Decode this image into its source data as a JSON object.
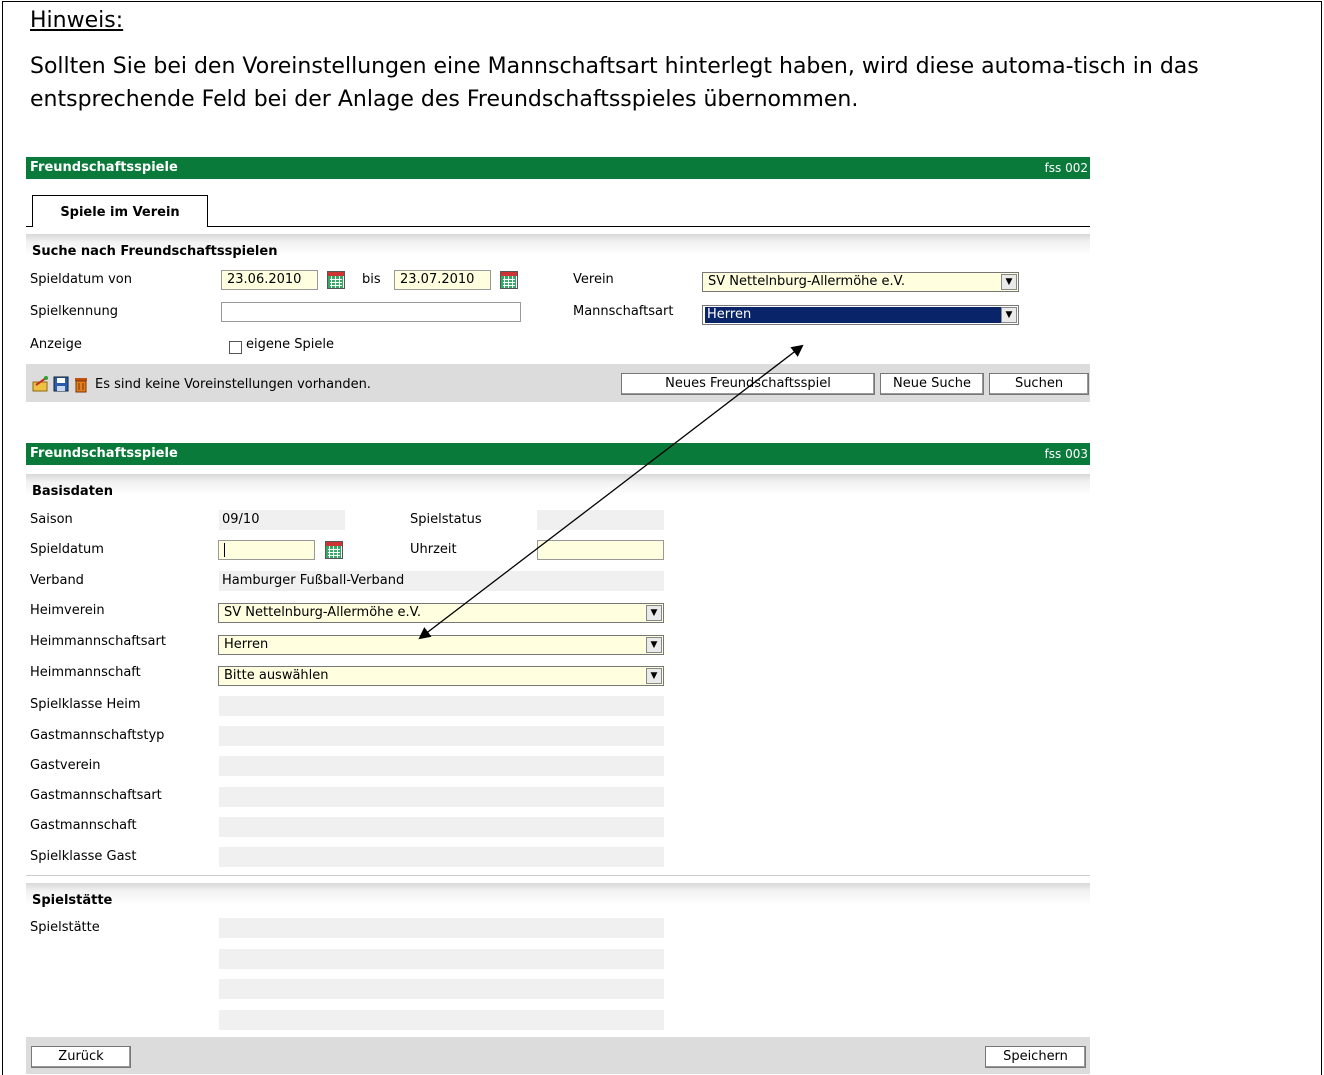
{
  "hint": {
    "title": "Hinweis:",
    "text": "Sollten Sie bei den Voreinstellungen eine Mannschaftsart hinterlegt haben, wird diese automa-tisch in das entsprechende Feld bei der Anlage des Freundschaftsspieles übernommen."
  },
  "search_panel": {
    "title": "Freundschaftsspiele",
    "code": "fss 002",
    "tab": "Spiele im Verein",
    "section_title": "Suche nach Freundschaftsspielen",
    "labels": {
      "date_from": "Spieldatum von",
      "to": "bis",
      "game_id": "Spielkennung",
      "display": "Anzeige",
      "club": "Verein",
      "team_type": "Mannschaftsart"
    },
    "values": {
      "date_from": "23.06.2010",
      "date_to": "23.07.2010",
      "game_id": "",
      "club": "SV Nettelnburg-Allermöhe e.V.",
      "team_type": "Herren",
      "own_games_label": "eigene Spiele"
    },
    "toolbar": {
      "status": "Es sind keine Voreinstellungen vorhanden.",
      "new_game": "Neues Freundschaftsspiel",
      "new_search": "Neue Suche",
      "search": "Suchen"
    }
  },
  "edit_panel": {
    "title": "Freundschaftsspiele",
    "code": "fss 003",
    "basisdaten_title": "Basisdaten",
    "labels": {
      "season": "Saison",
      "status": "Spielstatus",
      "date": "Spieldatum",
      "time": "Uhrzeit",
      "association": "Verband",
      "home_club": "Heimverein",
      "home_team_type": "Heimmannschaftsart",
      "home_team": "Heimmannschaft",
      "home_class": "Spielklasse Heim",
      "guest_team_kind": "Gastmannschaftstyp",
      "guest_club": "Gastverein",
      "guest_team_type": "Gastmannschaftsart",
      "guest_team": "Gastmannschaft",
      "guest_class": "Spielklasse Gast"
    },
    "values": {
      "season": "09/10",
      "status": "",
      "date": "",
      "time": "",
      "association": "Hamburger Fußball-Verband",
      "home_club": "SV Nettelnburg-Allermöhe e.V.",
      "home_team_type": "Herren",
      "home_team": "Bitte auswählen"
    },
    "venue_title": "Spielstätte",
    "venue_label": "Spielstätte",
    "buttons": {
      "back": "Zurück",
      "save": "Speichern"
    }
  },
  "colors": {
    "header_green": "#0a7a3a",
    "field_yellow": "#ffffe0",
    "selected_blue": "#0a246a"
  }
}
